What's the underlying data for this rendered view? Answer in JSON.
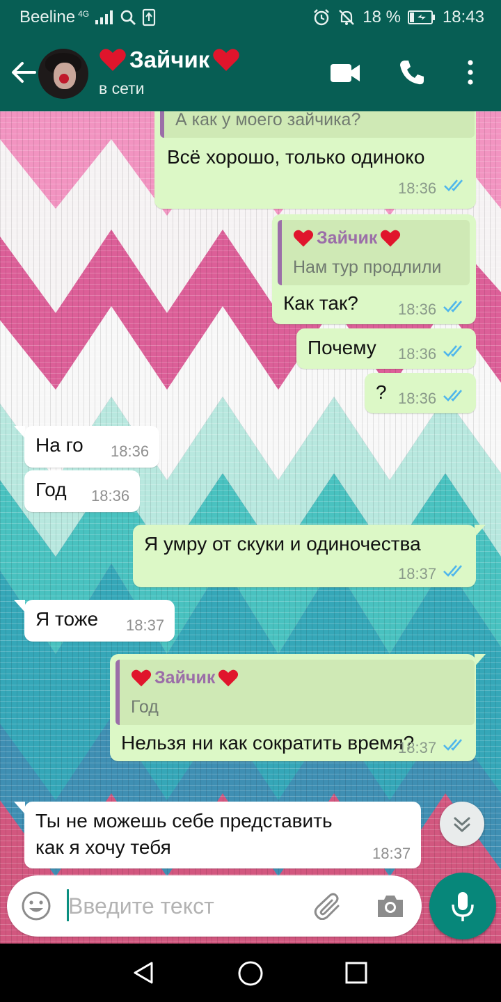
{
  "status_bar": {
    "carrier": "Beeline",
    "network": "4G",
    "battery": "18 %",
    "time": "18:43"
  },
  "header": {
    "contact_name": "Зайчик",
    "status": "в сети",
    "heart_color": "#e0152c"
  },
  "messages": [
    {
      "side": "out",
      "quote_text": "А как у моего зайчика?",
      "text": "Всё хорошо, только одиноко",
      "time": "18:36",
      "read": true
    },
    {
      "side": "out",
      "quote_name": "Зайчик",
      "quote_text": "Нам тур продлили",
      "text": "Как так?",
      "time": "18:36",
      "read": true
    },
    {
      "side": "out",
      "text": "Почему",
      "time": "18:36",
      "read": true
    },
    {
      "side": "out",
      "text": "?",
      "time": "18:36",
      "read": true
    },
    {
      "side": "in",
      "text": "На го",
      "time": "18:36"
    },
    {
      "side": "in",
      "text": "Год",
      "time": "18:36"
    },
    {
      "side": "out",
      "text": "Я умру от скуки и одиночества",
      "time": "18:37",
      "read": true
    },
    {
      "side": "in",
      "text": "Я тоже",
      "time": "18:37"
    },
    {
      "side": "out",
      "quote_name": "Зайчик",
      "quote_text": "Год",
      "text": "Нельзя ни как сократить время?",
      "time": "18:37",
      "read": true
    },
    {
      "side": "in",
      "text_line1": "Ты не можешь себе представить",
      "text_line2": "как я хочу тебя",
      "time": "18:37"
    }
  ],
  "composer": {
    "placeholder": "Введите текст"
  },
  "colors": {
    "header": "#075e54",
    "outgoing_bubble": "#dcf8c6",
    "incoming_bubble": "#ffffff",
    "read_ticks": "#4fb6ec",
    "mic_button": "#07877a",
    "quote_name": "#9b6ea8"
  }
}
